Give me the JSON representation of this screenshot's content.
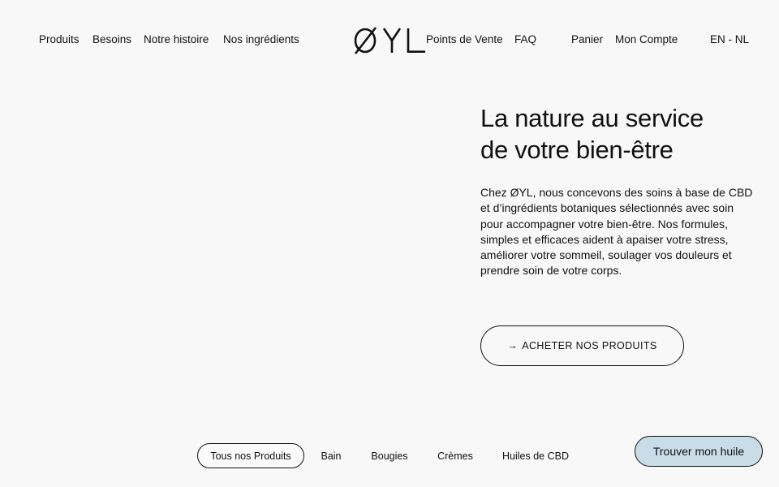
{
  "header": {
    "nav_left": [
      "Produits",
      "Besoins",
      "Notre histoire",
      "Nos ingrédients"
    ],
    "logo_text": "ØYL",
    "nav_right": [
      "Points de Vente",
      "FAQ"
    ],
    "cart_label": "Panier",
    "account_label": "Mon Compte",
    "language_label": "EN - NL"
  },
  "hero": {
    "title_line1": "La nature au service",
    "title_line2": "de votre bien-être",
    "description": "Chez ØYL, nous concevons des soins à base de CBD et d’ingrédients botaniques sélectionnés avec soin pour accompagner votre bien-être. Nos formules, simples et efficaces aident à apaiser votre stress, améliorer votre sommeil, soulager vos douleurs et prendre soin de votre corps.",
    "cta_arrow": "→",
    "cta_label": "ACHETER NOS PRODUITS"
  },
  "categories": {
    "active": "Tous nos Produits",
    "tabs": [
      "Tous nos Produits",
      "Bain",
      "Bougies",
      "Crèmes",
      "Huiles de CBD"
    ]
  },
  "finder": {
    "label": "Trouver mon huile",
    "background": "#c9dde8"
  }
}
